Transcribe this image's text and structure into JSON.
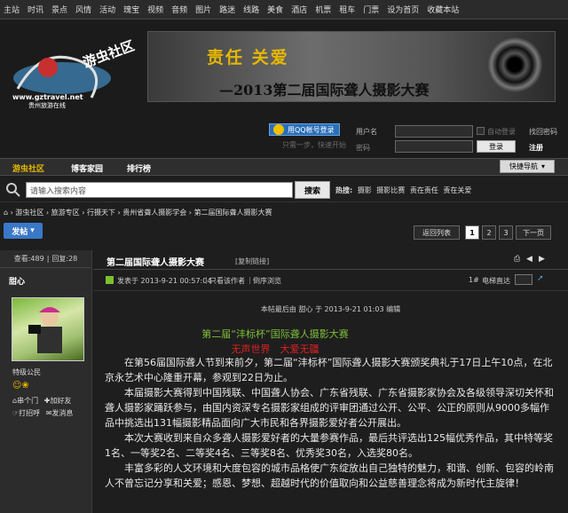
{
  "topnav": [
    "主站",
    "时讯",
    "景点",
    "风情",
    "活动",
    "瑰宝",
    "视频",
    "音频",
    "图片",
    "路迷",
    "线路",
    "美食",
    "酒店",
    "机票",
    "租车",
    "门票",
    "设为首页",
    "收藏本站"
  ],
  "logo": {
    "name": "游虫社区",
    "url": "www.gztravel.net",
    "sub": "贵州旅游在线"
  },
  "banner": {
    "slogan": "责任 关爱",
    "title": "—2013第二届国际聋人摄影大赛"
  },
  "login": {
    "qq_button": "用QQ帐号登录",
    "qq_sub": "只需一步，快速开始",
    "username_label": "用户名",
    "password_label": "密码",
    "auto_login": "自动登录",
    "forgot_password": "找回密码",
    "login_button": "登录",
    "register": "注册"
  },
  "nav": {
    "items": [
      "游虫社区",
      "博客家园",
      "排行榜"
    ],
    "quick_nav": "快捷导航"
  },
  "search": {
    "placeholder": "请输入搜索内容",
    "button": "搜索",
    "hot_label": "热搜:",
    "hot_items": [
      "摄影",
      "摄影比赛",
      "责在责任",
      "责在关爱"
    ]
  },
  "breadcrumb": [
    "游虫社区",
    "旅游专区",
    "行摄天下",
    "贵州省聋人摄影学会",
    "第二届国际聋人摄影大赛"
  ],
  "post_button": "发帖",
  "pager": {
    "back": "返回列表",
    "pages": [
      "1",
      "2",
      "3"
    ],
    "current": "1",
    "next": "下一页"
  },
  "thread": {
    "views_label": "查看:",
    "views": "489",
    "replies_label": "回复:",
    "replies": "28",
    "title": "第二届国际聋人摄影大赛",
    "copy_link": "[复制链接]",
    "author": "甜心",
    "rank": "特级公民",
    "actions": [
      "串个门",
      "加好友",
      "打招呼",
      "发消息"
    ],
    "post_meta": "发表于 2013-9-21 00:57:04",
    "only_author": "只看该作者",
    "reverse": "倒序浏览",
    "floor": "1#",
    "jump": "电梯直达",
    "edited": "本帖最后由 甜心 于 2013-9-21 01:03 编辑",
    "headline1": "第二届“沣标杯”国际聋人摄影大赛",
    "headline2": "无声世界　大爱无疆",
    "paragraphs": [
      "在第56届国际聋人节到来前夕，第二届“沣标杯”国际聋人摄影大赛颁奖典礼于17日上午10点，在北京永艺术中心隆重开幕，参观到22日为止。",
      "本届摄影大赛得到中国残联、中国聋人协会、广东省残联、广东省摄影家协会及各级领导深切关怀和聋人摄影家踊跃参与，由国内资深专名摄影家组成的评审团通过公开、公平、公正的原则从9000多幅作品中挑选出131幅摄影精品面向广大市民和各界摄影爱好者公开展出。",
      "本次大赛收到来自众多聋人摄影爱好者的大量参赛作品，最后共评选出125幅优秀作品，其中特等奖1名、一等奖2名、二等奖4名、三等奖8名、优秀奖30名，入选奖80名。",
      "丰富多彩的人文环境和大度包容的城市品格使广东绽放出自己独特的魅力，和谐、创新、包容的岭南人不曾忘记分享和关爱；感恩、梦想、超越时代的价值取向和公益慈善理念将成为新时代主旋律！"
    ]
  },
  "colors": {
    "accent": "#3a78c8",
    "headline1": "#7fbf3a",
    "headline2": "#e02020",
    "bg": "#1e1e1e"
  }
}
